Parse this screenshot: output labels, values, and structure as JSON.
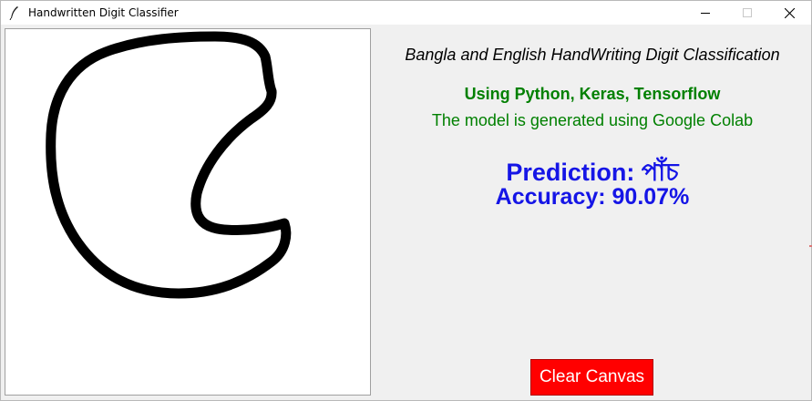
{
  "window": {
    "title": "Handwritten Digit Classifier",
    "controls": {
      "minimize_icon": "minimize-icon",
      "maximize_icon": "maximize-icon",
      "close_icon": "close-icon"
    }
  },
  "app": {
    "heading": "Bangla and English HandWriting Digit Classification",
    "tech_line": "Using Python, Keras, Tensorflow",
    "model_line": "The model is generated using Google Colab",
    "prediction_label": "Prediction: পাঁচ",
    "accuracy_label": "Accuracy: 90.07%",
    "clear_button": "Clear Canvas"
  },
  "colors": {
    "heading": "#000000",
    "info_green": "#008000",
    "result_blue": "#1515e6",
    "clear_button_bg": "#ff0000",
    "clear_button_text": "#ffffff",
    "canvas_bg": "#ffffff",
    "stroke": "#000000",
    "window_bg": "#f0f0f0"
  }
}
